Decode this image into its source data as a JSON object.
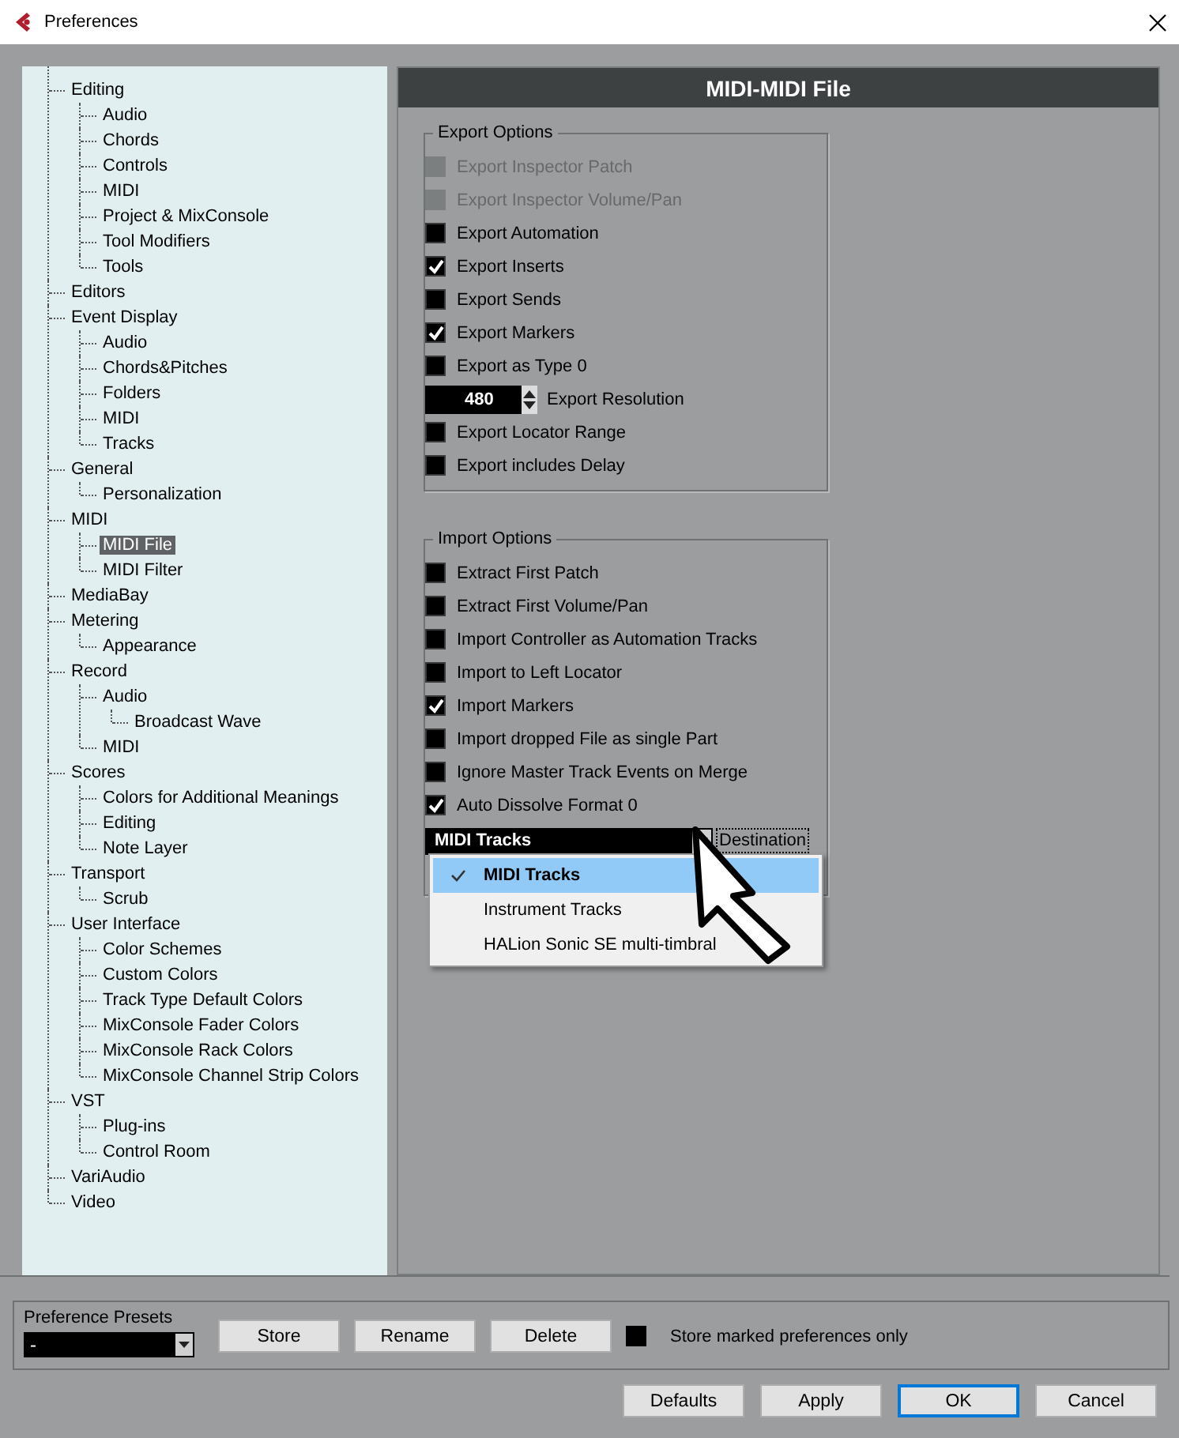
{
  "window": {
    "title": "Preferences"
  },
  "tree": [
    {
      "label": "Editing",
      "selected": false,
      "children": [
        {
          "label": "Audio",
          "selected": false
        },
        {
          "label": "Chords",
          "selected": false
        },
        {
          "label": "Controls",
          "selected": false
        },
        {
          "label": "MIDI",
          "selected": false
        },
        {
          "label": "Project & MixConsole",
          "selected": false
        },
        {
          "label": "Tool Modifiers",
          "selected": false
        },
        {
          "label": "Tools",
          "selected": false
        }
      ]
    },
    {
      "label": "Editors",
      "selected": false
    },
    {
      "label": "Event Display",
      "selected": false,
      "children": [
        {
          "label": "Audio",
          "selected": false
        },
        {
          "label": "Chords&Pitches",
          "selected": false
        },
        {
          "label": "Folders",
          "selected": false
        },
        {
          "label": "MIDI",
          "selected": false
        },
        {
          "label": "Tracks",
          "selected": false
        }
      ]
    },
    {
      "label": "General",
      "selected": false,
      "children": [
        {
          "label": "Personalization",
          "selected": false
        }
      ]
    },
    {
      "label": "MIDI",
      "selected": false,
      "children": [
        {
          "label": "MIDI File",
          "selected": true
        },
        {
          "label": "MIDI Filter",
          "selected": false
        }
      ]
    },
    {
      "label": "MediaBay",
      "selected": false
    },
    {
      "label": "Metering",
      "selected": false,
      "children": [
        {
          "label": "Appearance",
          "selected": false
        }
      ]
    },
    {
      "label": "Record",
      "selected": false,
      "children": [
        {
          "label": "Audio",
          "selected": false,
          "children": [
            {
              "label": "Broadcast Wave",
              "selected": false
            }
          ]
        },
        {
          "label": "MIDI",
          "selected": false
        }
      ]
    },
    {
      "label": "Scores",
      "selected": false,
      "children": [
        {
          "label": "Colors for Additional Meanings",
          "selected": false
        },
        {
          "label": "Editing",
          "selected": false
        },
        {
          "label": "Note Layer",
          "selected": false
        }
      ]
    },
    {
      "label": "Transport",
      "selected": false,
      "children": [
        {
          "label": "Scrub",
          "selected": false
        }
      ]
    },
    {
      "label": "User Interface",
      "selected": false,
      "children": [
        {
          "label": "Color Schemes",
          "selected": false
        },
        {
          "label": "Custom Colors",
          "selected": false
        },
        {
          "label": "Track Type Default Colors",
          "selected": false
        },
        {
          "label": "MixConsole Fader Colors",
          "selected": false
        },
        {
          "label": "MixConsole Rack Colors",
          "selected": false
        },
        {
          "label": "MixConsole Channel Strip Colors",
          "selected": false
        }
      ]
    },
    {
      "label": "VST",
      "selected": false,
      "children": [
        {
          "label": "Plug-ins",
          "selected": false
        },
        {
          "label": "Control Room",
          "selected": false
        }
      ]
    },
    {
      "label": "VariAudio",
      "selected": false
    },
    {
      "label": "Video",
      "selected": false
    }
  ],
  "panel": {
    "title": "MIDI-MIDI File"
  },
  "export_options": {
    "title": "Export Options",
    "items": [
      {
        "kind": "checkbox",
        "label": "Export Inspector Patch",
        "checked": false,
        "disabled": true
      },
      {
        "kind": "checkbox",
        "label": "Export Inspector Volume/Pan",
        "checked": false,
        "disabled": true
      },
      {
        "kind": "checkbox",
        "label": "Export Automation",
        "checked": false,
        "disabled": false
      },
      {
        "kind": "checkbox",
        "label": "Export Inserts",
        "checked": true,
        "disabled": false
      },
      {
        "kind": "checkbox",
        "label": "Export Sends",
        "checked": false,
        "disabled": false
      },
      {
        "kind": "checkbox",
        "label": "Export Markers",
        "checked": true,
        "disabled": false
      },
      {
        "kind": "checkbox",
        "label": "Export as Type 0",
        "checked": false,
        "disabled": false
      },
      {
        "kind": "spinner",
        "field": {
          "value": "480"
        },
        "label": "Export Resolution"
      },
      {
        "kind": "checkbox",
        "label": "Export Locator Range",
        "checked": false,
        "disabled": false
      },
      {
        "kind": "checkbox",
        "label": "Export includes Delay",
        "checked": false,
        "disabled": false
      }
    ]
  },
  "import_options": {
    "title": "Import Options",
    "items": [
      {
        "kind": "checkbox",
        "label": "Extract First Patch",
        "checked": false,
        "disabled": false
      },
      {
        "kind": "checkbox",
        "label": "Extract First Volume/Pan",
        "checked": false,
        "disabled": false
      },
      {
        "kind": "checkbox",
        "label": "Import Controller as Automation Tracks",
        "checked": false,
        "disabled": false
      },
      {
        "kind": "checkbox",
        "label": "Import to Left Locator",
        "checked": false,
        "disabled": false
      },
      {
        "kind": "checkbox",
        "label": "Import Markers",
        "checked": true,
        "disabled": false
      },
      {
        "kind": "checkbox",
        "label": "Import dropped File as single Part",
        "checked": false,
        "disabled": false
      },
      {
        "kind": "checkbox",
        "label": "Ignore Master Track Events on Merge",
        "checked": false,
        "disabled": false
      },
      {
        "kind": "checkbox",
        "label": "Auto Dissolve Format 0",
        "checked": true,
        "disabled": false
      }
    ],
    "destination": {
      "value": "MIDI Tracks",
      "label": "Destination",
      "expanded": true,
      "options": [
        {
          "label": "MIDI Tracks",
          "selected": true
        },
        {
          "label": "Instrument Tracks",
          "selected": false
        },
        {
          "label": "HALion Sonic SE multi-timbral",
          "selected": false
        }
      ]
    }
  },
  "presets": {
    "title": "Preference Presets",
    "value": "-",
    "buttons": [
      "Store",
      "Rename",
      "Delete"
    ],
    "store_marked": {
      "label": "Store marked preferences only",
      "checked": false
    }
  },
  "buttons": [
    {
      "label": "Defaults",
      "focused": false
    },
    {
      "label": "Apply",
      "focused": false
    },
    {
      "label": "OK",
      "focused": true
    },
    {
      "label": "Cancel",
      "focused": false
    }
  ]
}
